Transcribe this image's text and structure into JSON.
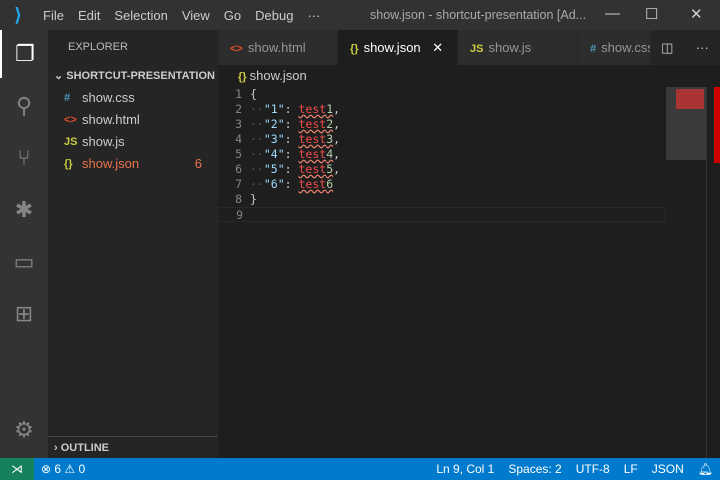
{
  "titlebar": {
    "menu": [
      "File",
      "Edit",
      "Selection",
      "View",
      "Go",
      "Debug",
      "···"
    ],
    "title": "show.json - shortcut-presentation [Ad..."
  },
  "sidebar": {
    "header": "EXPLORER",
    "section": "SHORTCUT-PRESENTATION",
    "files": [
      {
        "icon": "#",
        "name": "show.css",
        "color": "#519aba"
      },
      {
        "icon": "<>",
        "name": "show.html",
        "color": "#e44d26"
      },
      {
        "icon": "JS",
        "name": "show.js",
        "color": "#cbcb41"
      },
      {
        "icon": "{}",
        "name": "show.json",
        "color": "#cbcb41",
        "count": "6"
      }
    ],
    "outline": "OUTLINE"
  },
  "tabs": [
    {
      "icon": "<>",
      "label": "show.html"
    },
    {
      "icon": "{}",
      "label": "show.json",
      "close": "✕"
    },
    {
      "icon": "JS",
      "label": "show.js"
    },
    {
      "icon": "#",
      "label": "show.css"
    }
  ],
  "breadcrumb": "show.json",
  "editor": {
    "lines": [
      {
        "n": "1",
        "text": "{"
      },
      {
        "n": "2",
        "key": "\"1\"",
        "word": "test",
        "num": "1",
        "tail": ","
      },
      {
        "n": "3",
        "key": "\"2\"",
        "word": "test",
        "num": "2",
        "tail": ","
      },
      {
        "n": "4",
        "key": "\"3\"",
        "word": "test",
        "num": "3",
        "tail": ","
      },
      {
        "n": "5",
        "key": "\"4\"",
        "word": "test",
        "num": "4",
        "tail": ","
      },
      {
        "n": "6",
        "key": "\"5\"",
        "word": "test",
        "num": "5",
        "tail": ","
      },
      {
        "n": "7",
        "key": "\"6\"",
        "word": "test",
        "num": "6",
        "tail": ""
      },
      {
        "n": "8",
        "text": "}"
      },
      {
        "n": "9",
        "text": ""
      }
    ]
  },
  "status": {
    "errors": "6",
    "warnings": "0",
    "position": "Ln 9, Col 1",
    "spaces": "Spaces: 2",
    "encoding": "UTF-8",
    "eol": "LF",
    "language": "JSON"
  }
}
